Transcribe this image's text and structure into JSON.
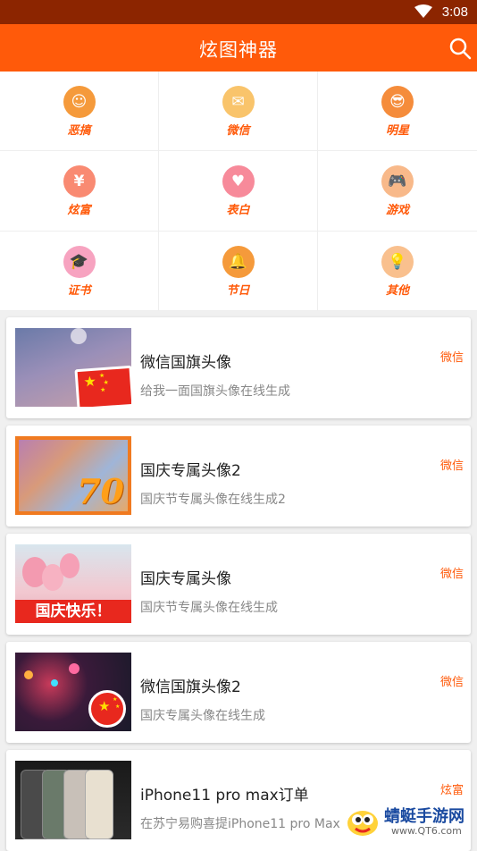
{
  "status": {
    "time": "3:08"
  },
  "appbar": {
    "title": "炫图神器"
  },
  "categories": [
    {
      "label": "恶搞",
      "icon": "prank-icon",
      "color": "#f59a3b"
    },
    {
      "label": "微信",
      "icon": "wechat-icon",
      "color": "#f9c46b"
    },
    {
      "label": "明星",
      "icon": "star-icon",
      "color": "#f58c3b"
    },
    {
      "label": "炫富",
      "icon": "money-icon",
      "color": "#f98a72"
    },
    {
      "label": "表白",
      "icon": "heart-icon",
      "color": "#f78a9a"
    },
    {
      "label": "游戏",
      "icon": "game-icon",
      "color": "#f8b98a"
    },
    {
      "label": "证书",
      "icon": "certificate-icon",
      "color": "#f7a3c0"
    },
    {
      "label": "节日",
      "icon": "bell-icon",
      "color": "#f59a3b"
    },
    {
      "label": "其他",
      "icon": "bulb-icon",
      "color": "#f9c08e"
    }
  ],
  "items": [
    {
      "title": "微信国旗头像",
      "desc": "给我一面国旗头像在线生成",
      "tag": "微信"
    },
    {
      "title": "国庆专属头像2",
      "desc": "国庆节专属头像在线生成2",
      "tag": "微信"
    },
    {
      "title": "国庆专属头像",
      "desc": "国庆节专属头像在线生成",
      "tag": "微信"
    },
    {
      "title": "微信国旗头像2",
      "desc": "国庆专属头像在线生成",
      "tag": "微信"
    },
    {
      "title": "iPhone11 pro max订单",
      "desc": "在苏宁易购喜提iPhone11 pro Max",
      "tag": "炫富"
    }
  ],
  "thumbs": {
    "badge70": "70",
    "festival_text": "国庆快乐！"
  },
  "watermark": {
    "name": "蜻蜓手游网",
    "url": "www.QT6.com"
  }
}
